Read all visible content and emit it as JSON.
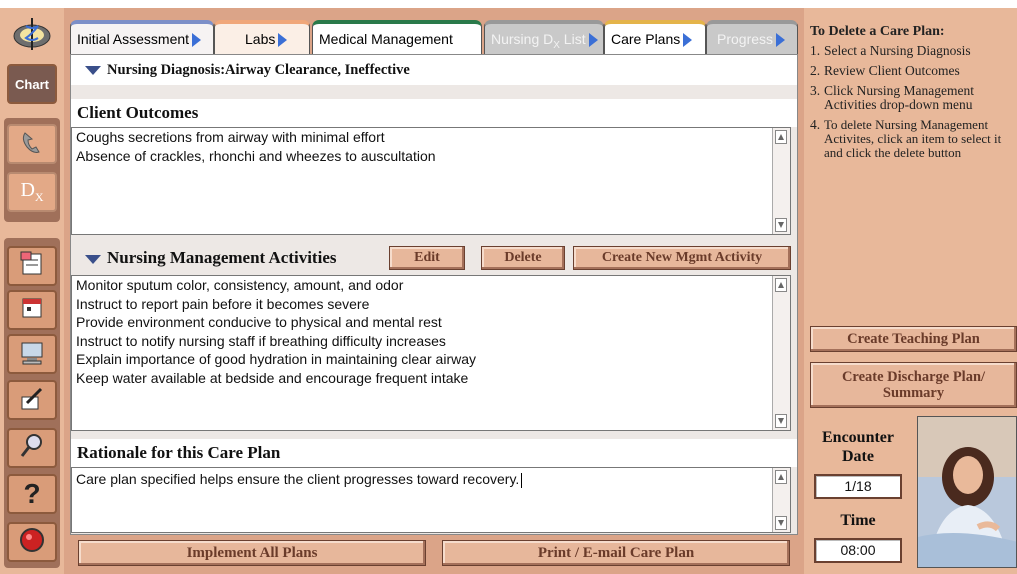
{
  "tabs": [
    {
      "label": "Initial Assessment",
      "arrow": true,
      "bg": "#f6f3f3"
    },
    {
      "label": "Labs",
      "arrow": true,
      "bg": "#fbefe6"
    },
    {
      "label": "Medical Management",
      "arrow": false,
      "bg": "#ffffff"
    },
    {
      "label": "Nursing D",
      "sub": "X",
      "label_suffix": " List",
      "arrow": true,
      "bg": "#c9c9c9"
    },
    {
      "label": "Care Plans",
      "arrow": true,
      "bg": "#ffffff"
    },
    {
      "label": "Progress",
      "arrow": true,
      "bg": "#c9c9c9"
    }
  ],
  "diagnosis": {
    "label": "Nursing Diagnosis:Airway Clearance, Ineffective"
  },
  "client_outcomes": {
    "title": "Client Outcomes",
    "lines": [
      "Coughs secretions from airway with minimal effort",
      "Absence of crackles, rhonchi and wheezes to auscultation"
    ]
  },
  "mgmt": {
    "title": "Nursing Management Activities",
    "edit_label": "Edit",
    "delete_label": "Delete",
    "create_label": "Create New Mgmt Activity",
    "lines": [
      "Monitor sputum color, consistency, amount, and odor",
      "Instruct to report pain before it becomes severe",
      "Provide environment conducive to physical and mental rest",
      "Instruct to notify nursing staff if breathing difficulty increases",
      "Explain importance of good hydration in maintaining clear airway",
      "Keep water available at bedside and encourage frequent intake"
    ]
  },
  "rationale": {
    "title": "Rationale for this Care Plan",
    "text": "Care plan specified helps ensure the client progresses toward recovery."
  },
  "bottom": {
    "implement_label": "Implement All Plans",
    "print_label": "Print / E-mail Care Plan"
  },
  "instructions": {
    "heading": "To Delete a Care Plan:",
    "steps": [
      {
        "n": "1.",
        "text": "Select a Nursing Diagnosis"
      },
      {
        "n": "2.",
        "text": "Review Client Outcomes"
      },
      {
        "n": "3.",
        "text": "Click Nursing Management Activities drop-down menu"
      },
      {
        "n": "4.",
        "text": "To delete Nursing Management Activites, click an item to select it and click the delete button"
      }
    ]
  },
  "side": {
    "teaching_label": "Create Teaching Plan",
    "discharge_label_1": "Create Discharge Plan/",
    "discharge_label_2": "Summary",
    "encounter_1": "Encounter",
    "encounter_2": "Date",
    "date_value": "1/18",
    "time_label": "Time",
    "time_value": "08:00"
  },
  "rail": {
    "logo_icon": "caduceus-logo-icon",
    "chart_label": "Chart",
    "dx_label": "D",
    "dx_sub": "X",
    "icons": [
      "phone-icon",
      "note-icon",
      "computer-icon",
      "pencil-icon",
      "magnifier-icon",
      "help-icon",
      "stop-icon"
    ],
    "help_glyph": "?"
  },
  "colors": {
    "panel": "#dba488",
    "rail": "#e8b89a",
    "accent_blue": "#3b6fd6",
    "button": "#e7b79b"
  }
}
